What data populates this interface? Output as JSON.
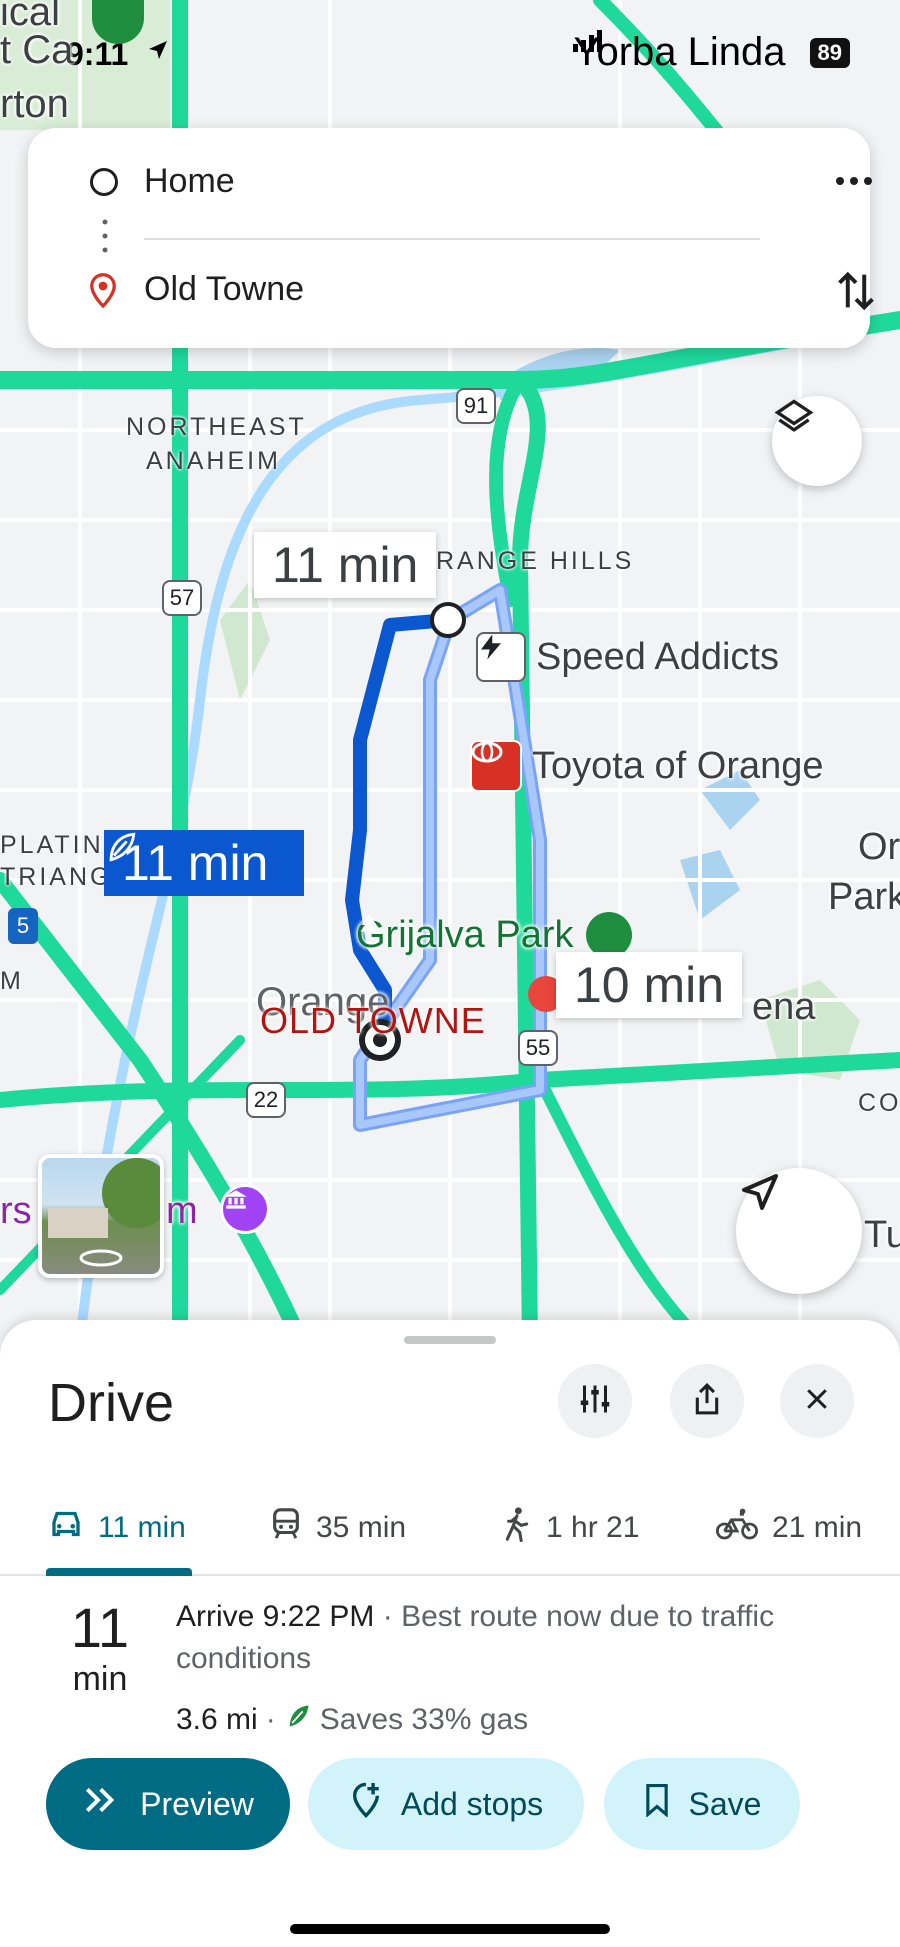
{
  "status": {
    "time": "9:11",
    "location_arrow": "▲",
    "right_text": "Yorba Linda",
    "battery": "89"
  },
  "search": {
    "origin": "Home",
    "destination": "Old Towne",
    "more_icon": "more-horiz-icon",
    "swap_icon": "swap-vert-icon"
  },
  "map": {
    "labels": {
      "corner_tl_1": "ical",
      "corner_tl_2": "t Ca",
      "corner_tl_3": "rton",
      "northeast_anaheim_1": "NORTHEAST",
      "northeast_anaheim_2": "ANAHEIM",
      "orange_hills": "RANGE HILLS",
      "platinum_1": "PLATIN",
      "platinum_2": "TRIANG",
      "old_towne": "OLD TOWNE",
      "orange_city": "Orange",
      "right_or": "Or",
      "right_park": "Park",
      "right_co": "CO",
      "right_tu": "Tu",
      "right_ena": "ena",
      "left_rs": "rs",
      "left_m": "m",
      "left_m2": "M"
    },
    "pois": {
      "speed_addicts": "Speed Addicts",
      "toyota": "Toyota of Orange",
      "grijalva": "Grijalva Park"
    },
    "shields": {
      "r91": "91",
      "r57": "57",
      "r55": "55",
      "r22": "22",
      "r5": "5"
    },
    "bubbles": {
      "alt_top": "11 min",
      "selected": "11 min",
      "alt_right": "10 min"
    },
    "colors": {
      "highway": "#1fd99b",
      "route": "#0b57d0",
      "alt_route": "#a8c7fa"
    }
  },
  "sheet": {
    "title": "Drive",
    "tabs": [
      {
        "label": "11 min",
        "icon": "car-icon"
      },
      {
        "label": "35 min",
        "icon": "transit-icon"
      },
      {
        "label": "1 hr 21",
        "icon": "walk-icon"
      },
      {
        "label": "21 min",
        "icon": "bike-icon"
      }
    ],
    "duration_number": "11",
    "duration_unit": "min",
    "arrive": "Arrive 9:22 PM",
    "separator": " · ",
    "reason": "Best route now due to traffic conditions",
    "distance": "3.6 mi",
    "savings": "Saves 33% gas",
    "buttons": {
      "preview": "Preview",
      "add_stops": "Add stops",
      "save": "Save"
    }
  }
}
